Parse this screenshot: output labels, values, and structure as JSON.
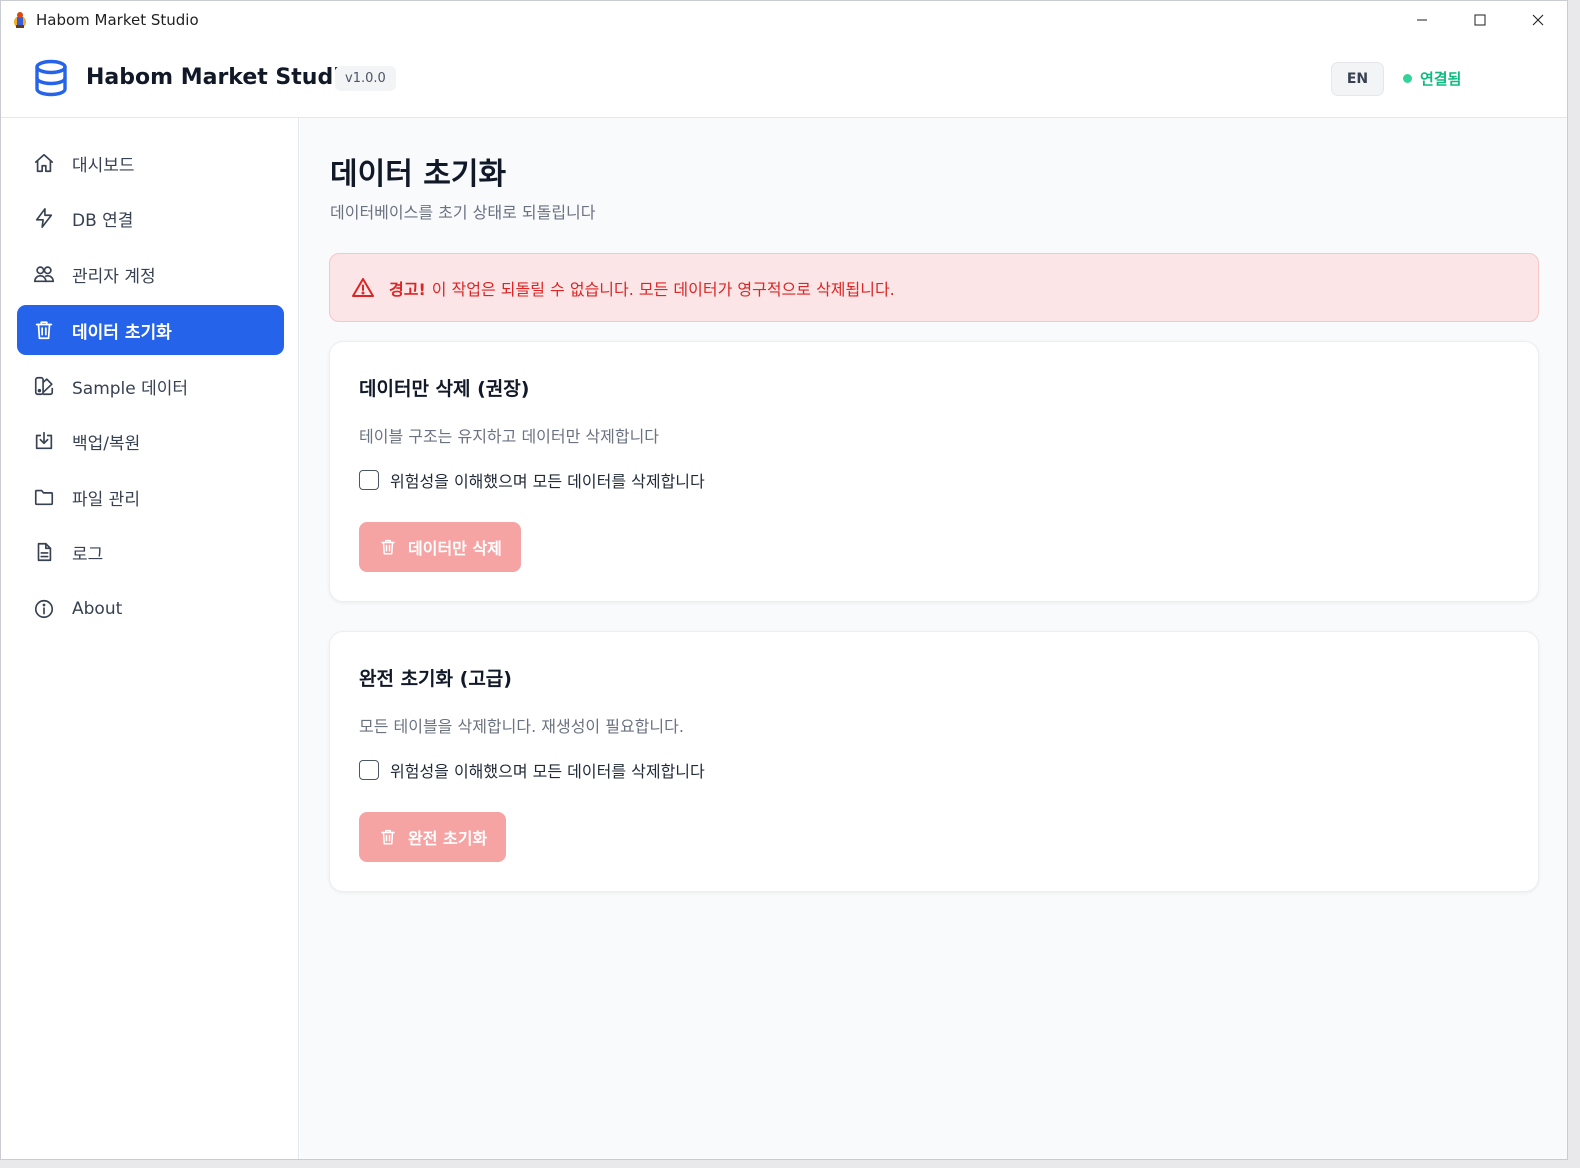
{
  "window": {
    "title": "Habom Market Studio"
  },
  "header": {
    "brand": "Habom Market Studio",
    "version": "v1.0.0",
    "language_button": "EN",
    "connection_status": "연결됨"
  },
  "sidebar": {
    "items": [
      {
        "label": "대시보드",
        "icon": "home-icon",
        "active": false
      },
      {
        "label": "DB 연결",
        "icon": "lightning-icon",
        "active": false
      },
      {
        "label": "관리자 계정",
        "icon": "users-icon",
        "active": false
      },
      {
        "label": "데이터 초기화",
        "icon": "trash-icon",
        "active": true
      },
      {
        "label": "Sample 데이터",
        "icon": "swatch-icon",
        "active": false
      },
      {
        "label": "백업/복원",
        "icon": "download-tray-icon",
        "active": false
      },
      {
        "label": "파일 관리",
        "icon": "folder-icon",
        "active": false
      },
      {
        "label": "로그",
        "icon": "document-icon",
        "active": false
      },
      {
        "label": "About",
        "icon": "info-icon",
        "active": false
      }
    ]
  },
  "main": {
    "title": "데이터 초기화",
    "subtitle": "데이터베이스를 초기 상태로 되돌립니다",
    "alert": {
      "strong": "경고!",
      "text": "이 작업은 되돌릴 수 없습니다. 모든 데이터가 영구적으로 삭제됩니다."
    },
    "cards": [
      {
        "title": "데이터만 삭제 (권장)",
        "description": "테이블 구조는 유지하고 데이터만 삭제합니다",
        "checkbox_label": "위험성을 이해했으며 모든 데이터를 삭제합니다",
        "checked": false,
        "button_label": "데이터만 삭제"
      },
      {
        "title": "완전 초기화 (고급)",
        "description": "모든 테이블을 삭제합니다. 재생성이 필요합니다.",
        "checkbox_label": "위험성을 이해했으며 모든 데이터를 삭제합니다",
        "checked": false,
        "button_label": "완전 초기화"
      }
    ]
  },
  "colors": {
    "accent": "#2563eb",
    "danger": "#dc2626",
    "danger_disabled": "#f6a3a3",
    "status": "#10b981"
  }
}
